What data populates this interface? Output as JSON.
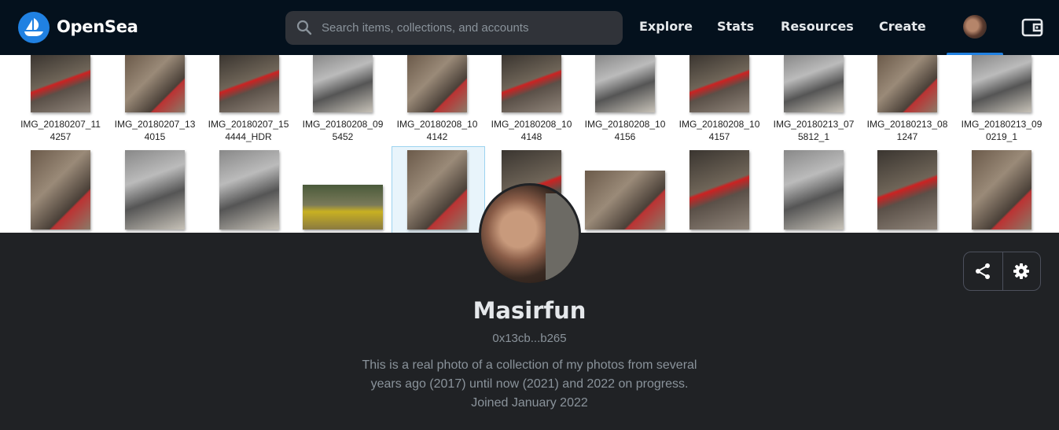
{
  "nav": {
    "brand": "OpenSea",
    "search_placeholder": "Search items, collections, and accounts",
    "links": [
      "Explore",
      "Stats",
      "Resources",
      "Create"
    ]
  },
  "banner": {
    "captions": [
      [
        "IMG_20180207_11",
        "4257"
      ],
      [
        "IMG_20180207_13",
        "4015"
      ],
      [
        "IMG_20180207_15",
        "4444_HDR"
      ],
      [
        "IMG_20180208_09",
        "5452"
      ],
      [
        "IMG_20180208_10",
        "4142"
      ],
      [
        "IMG_20180208_10",
        "4148"
      ],
      [
        "IMG_20180208_10",
        "4156"
      ],
      [
        "IMG_20180208_10",
        "4157"
      ],
      [
        "IMG_20180213_07",
        "5812_1"
      ],
      [
        "IMG_20180213_08",
        "1247"
      ],
      [
        "IMG_20180213_09",
        "0219_1"
      ]
    ]
  },
  "profile": {
    "username": "Masirfun",
    "address": "0x13cb...b265",
    "bio_line1": "This is a real photo of a collection of my photos from several",
    "bio_line2": "years ago (2017) until now (2021) and 2022 on progress.",
    "joined": "Joined January 2022"
  },
  "colors": {
    "accent": "#2081e2",
    "nav_bg": "#04111d",
    "page_bg": "#202225"
  },
  "icons": [
    "opensea-logo-icon",
    "search-icon",
    "wallet-icon",
    "share-icon",
    "gear-icon"
  ]
}
